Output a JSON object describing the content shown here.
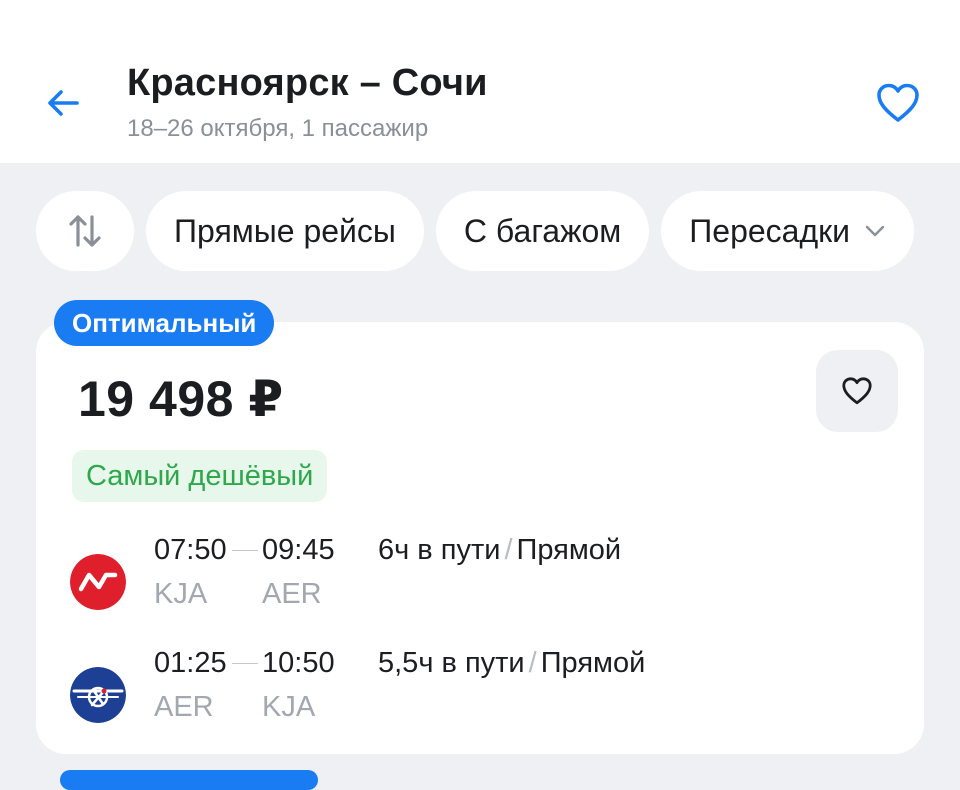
{
  "header": {
    "title": "Красноярск – Сочи",
    "subtitle": "18–26 октября, 1 пассажир",
    "back_icon": "arrow-left-icon",
    "favorite_icon": "heart-outline-icon",
    "accent": "#1a7cf2"
  },
  "filters": [
    {
      "icon": "sort-arrows-icon"
    },
    {
      "label": "Прямые рейсы"
    },
    {
      "label": "С багажом"
    },
    {
      "label": "Пересадки",
      "icon": "chevron-down-icon"
    }
  ],
  "offer": {
    "badge": "Оптимальный",
    "price": "19 498 ₽",
    "tag": "Самый дешёвый",
    "favorite_icon": "heart-outline-icon",
    "flights": [
      {
        "airline_logo": "nordwind-logo",
        "depart_time": "07:50",
        "arrive_time": "09:45",
        "from": "KJA",
        "to": "AER",
        "duration": "6ч в пути",
        "separator": "/",
        "type": "Прямой"
      },
      {
        "airline_logo": "aeroflot-logo",
        "depart_time": "01:25",
        "arrive_time": "10:50",
        "from": "AER",
        "to": "KJA",
        "duration": "5,5ч в пути",
        "separator": "/",
        "type": "Прямой"
      }
    ]
  },
  "colors": {
    "badge_blue": "#1a7cf2",
    "cheap_green": "#2ea84a",
    "cheap_bg": "#e8f7ec",
    "page_bg": "#eef0f4"
  }
}
